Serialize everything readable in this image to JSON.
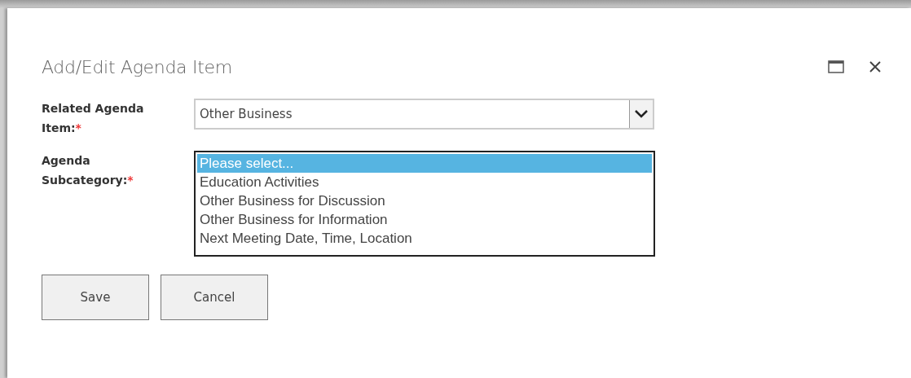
{
  "dialog": {
    "title": "Add/Edit Agenda Item"
  },
  "fields": [
    {
      "kind": "dropdown",
      "label": "Related Agenda Item:",
      "required_mark": "*",
      "value": "Other Business"
    },
    {
      "kind": "listbox",
      "label": "Agenda Subcategory:",
      "required_mark": "*",
      "options": [
        {
          "label": "Please select...",
          "selected": true
        },
        {
          "label": "Education Activities",
          "selected": false
        },
        {
          "label": "Other Business for Discussion",
          "selected": false
        },
        {
          "label": "Other Business for Information",
          "selected": false
        },
        {
          "label": "Next Meeting Date, Time, Location",
          "selected": false
        }
      ]
    }
  ],
  "buttons": [
    "Save",
    "Cancel"
  ]
}
